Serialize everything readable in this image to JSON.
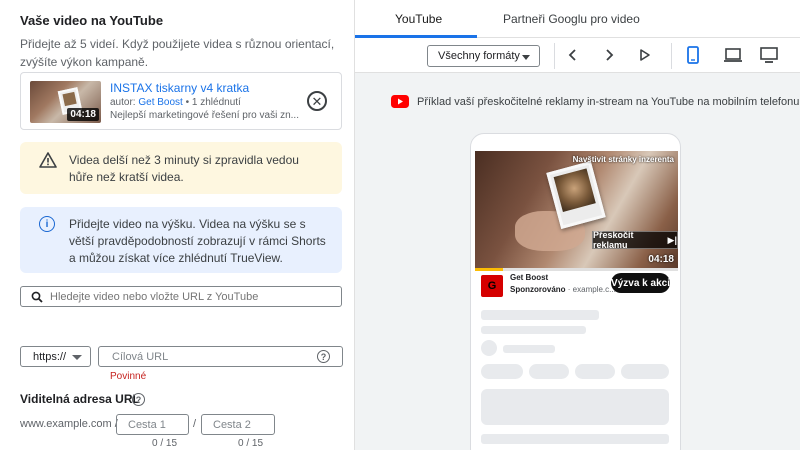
{
  "left_panel": {
    "title": "Vaše video na YouTube",
    "subtitle": "Přidejte až 5 videí. Když použijete videa s různou orientací, zvýšíte výkon kampaně.",
    "video": {
      "title": "INSTAX tiskarny v4 kratka",
      "author_prefix": "autor: ",
      "channel": "Get Boost",
      "views": " • 1 zhlédnutí",
      "description": "Nejlepší marketingové řešení pro vaši zn...",
      "duration": "04:18"
    },
    "warning": "Videa delší než 3 minuty si zpravidla vedou hůře než kratší videa.",
    "info": "Přidejte video na výšku. Videa na výšku se s větší pravděpodobností zobrazují v rámci Shorts a můžou získat více zhlédnutí TrueView.",
    "search_placeholder": "Hledejte video nebo vložte URL z YouTube",
    "protocol": "https://",
    "final_url_placeholder": "Cílová URL",
    "required": "Povinné",
    "display_url_label": "Viditelná adresa URL",
    "display_domain": "www.example.com /",
    "path1_placeholder": "Cesta 1",
    "path2_placeholder": "Cesta 2",
    "path1_count": "0 / 15",
    "path2_count": "0 / 15",
    "slash": "/"
  },
  "right_panel": {
    "tabs": [
      {
        "label": "YouTube",
        "active": true
      },
      {
        "label": "Partneři Googlu pro video",
        "active": false
      }
    ],
    "format_select": "Všechny formáty",
    "active_device": "mobile",
    "example_caption": "Příklad vaší přeskočitelné reklamy in-stream na YouTube na mobilním telefonu",
    "preview": {
      "visit_site": "Navštivit stránky inzerenta",
      "skip_ad": "Přeskočit reklamu",
      "duration": "04:18",
      "progress": 0.14,
      "advertiser": "Get Boost",
      "sponsored": "Sponzorováno",
      "domain_suffix": " · example.c...",
      "cta": "Výzva k akci"
    }
  },
  "colors": {
    "accent": "#1a73e8",
    "warning_bg": "#fef7e0",
    "info_bg": "#e8f0fe",
    "error": "#c5221f",
    "youtube_red": "#ff0000"
  }
}
